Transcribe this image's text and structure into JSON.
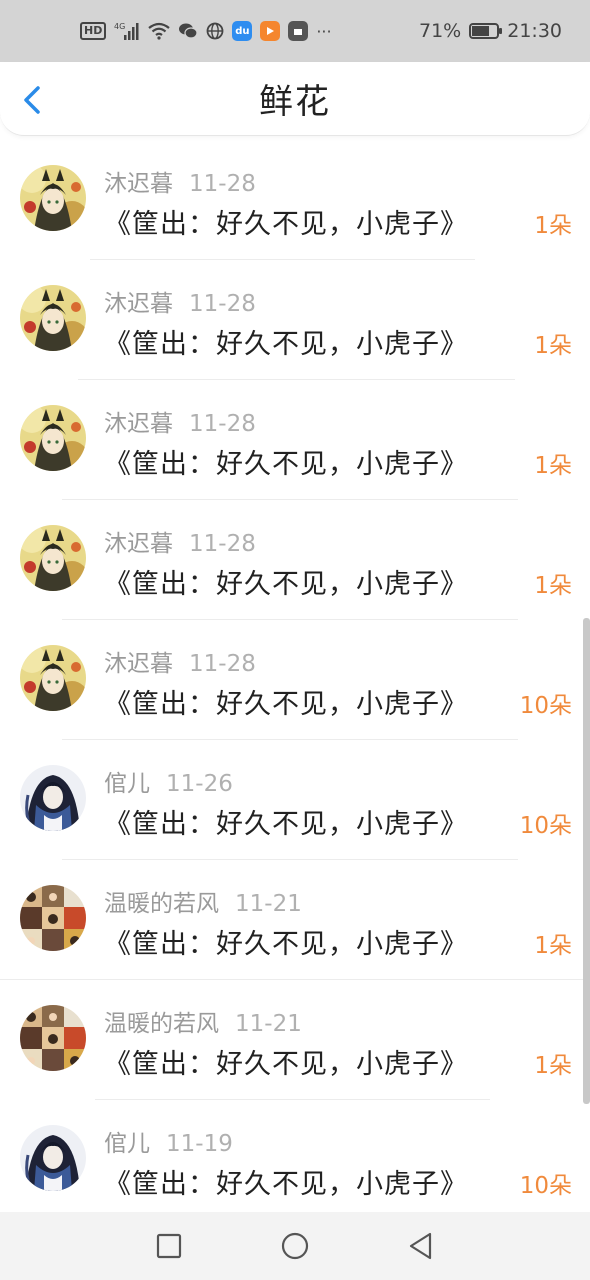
{
  "status_bar": {
    "hd": "HD",
    "network": "4G",
    "dots": "···",
    "battery": "71%",
    "battery_level": 0.71,
    "time": "21:30"
  },
  "header": {
    "title": "鲜花",
    "back_icon": "chevron-left-icon"
  },
  "colors": {
    "accent": "#f08a3c",
    "back": "#2a8be8",
    "muted": "#9a9a9a"
  },
  "items": [
    {
      "name": "沐迟暮",
      "date": "11-28",
      "book": "《筐出：好久不见，小虎子》",
      "count": "1朵",
      "avatar": "avatar-a"
    },
    {
      "name": "沐迟暮",
      "date": "11-28",
      "book": "《筐出：好久不见，小虎子》",
      "count": "1朵",
      "avatar": "avatar-a"
    },
    {
      "name": "沐迟暮",
      "date": "11-28",
      "book": "《筐出：好久不见，小虎子》",
      "count": "1朵",
      "avatar": "avatar-a"
    },
    {
      "name": "沐迟暮",
      "date": "11-28",
      "book": "《筐出：好久不见，小虎子》",
      "count": "1朵",
      "avatar": "avatar-a"
    },
    {
      "name": "沐迟暮",
      "date": "11-28",
      "book": "《筐出：好久不见，小虎子》",
      "count": "10朵",
      "avatar": "avatar-a"
    },
    {
      "name": "倌儿",
      "date": "11-26",
      "book": "《筐出：好久不见，小虎子》",
      "count": "10朵",
      "avatar": "avatar-b"
    },
    {
      "name": "温暖的若风",
      "date": "11-21",
      "book": "《筐出：好久不见，小虎子》",
      "count": "1朵",
      "avatar": "avatar-c"
    },
    {
      "name": "温暖的若风",
      "date": "11-21",
      "book": "《筐出：好久不见，小虎子》",
      "count": "1朵",
      "avatar": "avatar-c"
    },
    {
      "name": "倌儿",
      "date": "11-19",
      "book": "《筐出：好久不见，小虎子》",
      "count": "10朵",
      "avatar": "avatar-b"
    }
  ],
  "nav": {
    "buttons": [
      "recent-apps-icon",
      "home-icon",
      "back-triangle-icon"
    ]
  }
}
